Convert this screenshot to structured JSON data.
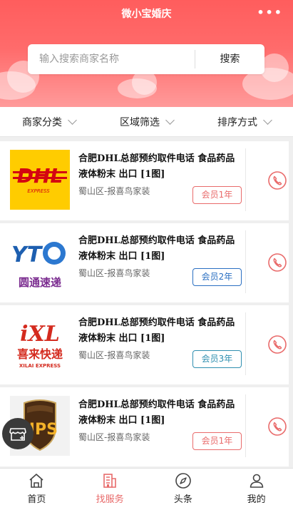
{
  "header": {
    "title": "微小宝婚庆",
    "more_label": "•••"
  },
  "search": {
    "placeholder": "输入搜索商家名称",
    "button_label": "搜索"
  },
  "filters": [
    {
      "label": "商家分类"
    },
    {
      "label": "区域筛选"
    },
    {
      "label": "排序方式"
    }
  ],
  "merchants": [
    {
      "name": "合肥DHL总部预约取件电话 食品药品液体粉末 出口 [1图]",
      "address": "蜀山区-报喜鸟家装",
      "badge": "会员1年",
      "badge_color": "#e96b6b",
      "logo": "DHL"
    },
    {
      "name": "合肥DHL总部预约取件电话 食品药品液体粉末 出口 [1图]",
      "address": "蜀山区-报喜鸟家装",
      "badge": "会员2年",
      "badge_color": "#2a6fc2",
      "logo": "YTO"
    },
    {
      "name": "合肥DHL总部预约取件电话 食品药品液体粉末 出口 [1图]",
      "address": "蜀山区-报喜鸟家装",
      "badge": "会员3年",
      "badge_color": "#2f8fb0",
      "logo": "iXL"
    },
    {
      "name": "合肥DHL总部预约取件电话 食品药品液体粉末 出口 [1图]",
      "address": "蜀山区-报喜鸟家装",
      "badge": "会员1年",
      "badge_color": "#e96b6b",
      "logo": "UPS"
    }
  ],
  "logos": {
    "dhl": {
      "text": "DHL",
      "sub": "EXPRESS"
    },
    "yto": {
      "text": "YT",
      "sub": "圆通速递"
    },
    "ixl": {
      "text": "iXL",
      "sub": "喜来快递",
      "sub2": "XILAI EXPRESS"
    },
    "ups": {
      "text": "UPS"
    }
  },
  "tabbar": [
    {
      "label": "首页",
      "icon": "home-icon",
      "active": false
    },
    {
      "label": "找服务",
      "icon": "building-icon",
      "active": true
    },
    {
      "label": "头条",
      "icon": "compass-icon",
      "active": false
    },
    {
      "label": "我的",
      "icon": "user-icon",
      "active": false
    }
  ],
  "colors": {
    "accent": "#ff6060",
    "active_tab": "#e86a6a",
    "phone": "#e96b6b"
  }
}
